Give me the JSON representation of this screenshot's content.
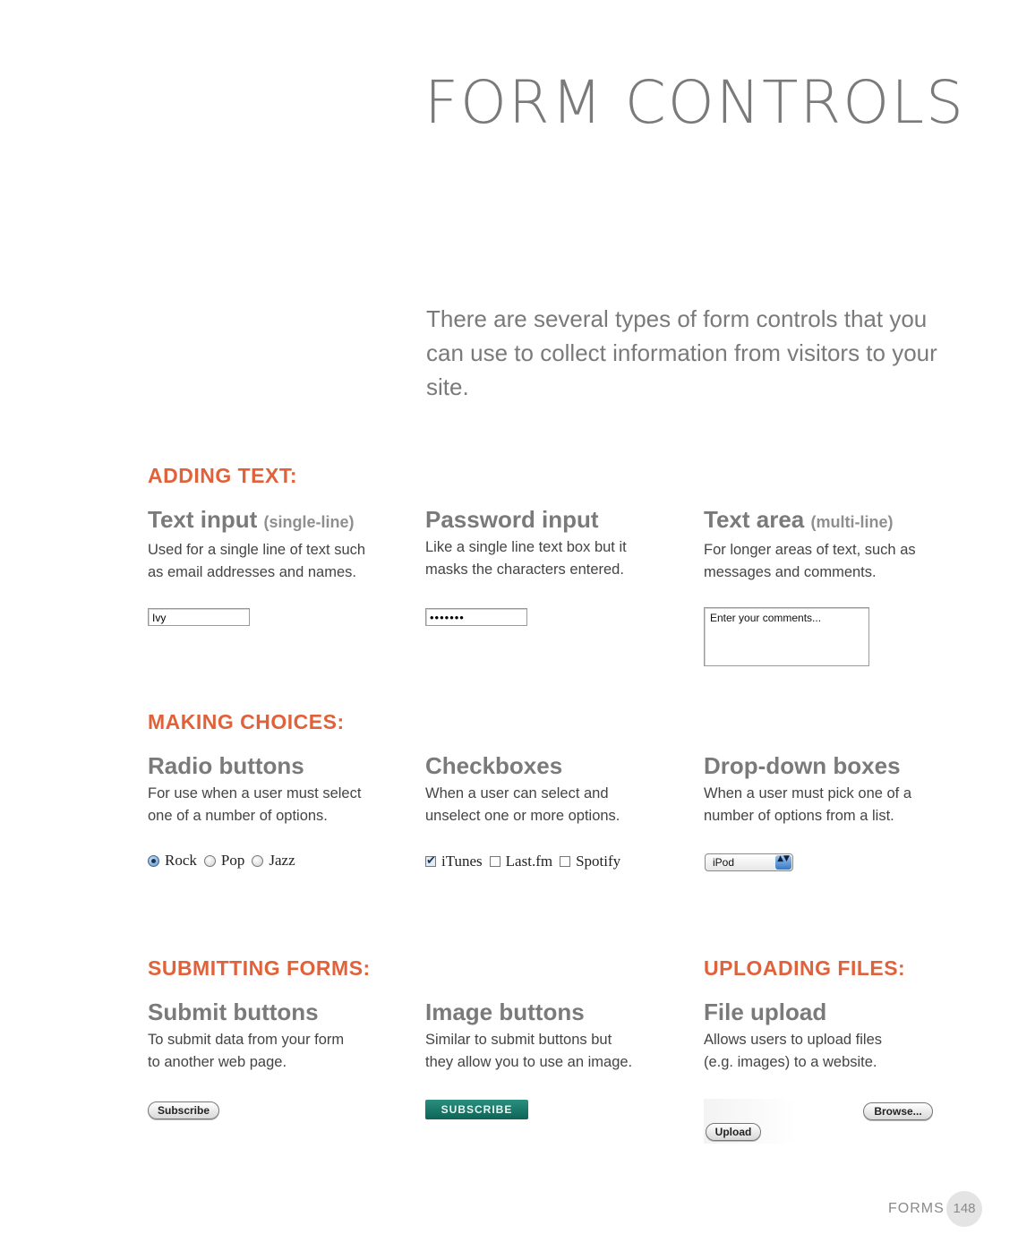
{
  "page": {
    "title": "FORM CONTROLS",
    "intro": "There are several types of form controls that you can use to collect information from visitors to your site."
  },
  "sections": {
    "adding_text": {
      "heading": "ADDING TEXT:",
      "text_input": {
        "title": "Text input",
        "note": "(single-line)",
        "description": "Used for a single line of text such\nas email addresses and names.",
        "value": "Ivy"
      },
      "password_input": {
        "title": "Password input",
        "description": "Like a single line text box but it\nmasks the characters entered.",
        "value": "•••••••"
      },
      "text_area": {
        "title": "Text area",
        "note": "(multi-line)",
        "description": "For longer areas of text, such as\nmessages and comments.",
        "value": "Enter your comments..."
      }
    },
    "making_choices": {
      "heading": "MAKING CHOICES:",
      "radio": {
        "title": "Radio buttons",
        "description": "For use when a user must select\none of a number of options.",
        "options": [
          {
            "label": "Rock",
            "selected": true
          },
          {
            "label": "Pop",
            "selected": false
          },
          {
            "label": "Jazz",
            "selected": false
          }
        ]
      },
      "checkbox": {
        "title": "Checkboxes",
        "description": "When a user can select and\nunselect one or more options.",
        "options": [
          {
            "label": "iTunes",
            "checked": true,
            "mark": "✔"
          },
          {
            "label": "Last.fm",
            "checked": false,
            "mark": ""
          },
          {
            "label": "Spotify",
            "checked": false,
            "mark": ""
          }
        ]
      },
      "dropdown": {
        "title": "Drop-down boxes",
        "description": "When a user must pick one of a\nnumber of options from a list.",
        "selected": "iPod",
        "arrows": "▲▼"
      }
    },
    "submitting": {
      "heading": "SUBMITTING FORMS:",
      "submit": {
        "title": "Submit buttons",
        "description": "To submit data from your form\nto another web page.",
        "button_label": "Subscribe"
      },
      "image": {
        "title": "Image buttons",
        "description": "Similar to submit buttons but\nthey allow you to use an image.",
        "button_label": "SUBSCRIBE"
      }
    },
    "uploading": {
      "heading": "UPLOADING FILES:",
      "file": {
        "title": "File upload",
        "description": "Allows users to upload files\n(e.g. images) to a website.",
        "browse_label": "Browse...",
        "upload_label": "Upload"
      }
    }
  },
  "footer": {
    "section": "FORMS",
    "page_number": "148"
  },
  "colors": {
    "heading_accent": "#e0623a",
    "title_gray": "#7a7a7a",
    "image_button": "#0c6457"
  }
}
